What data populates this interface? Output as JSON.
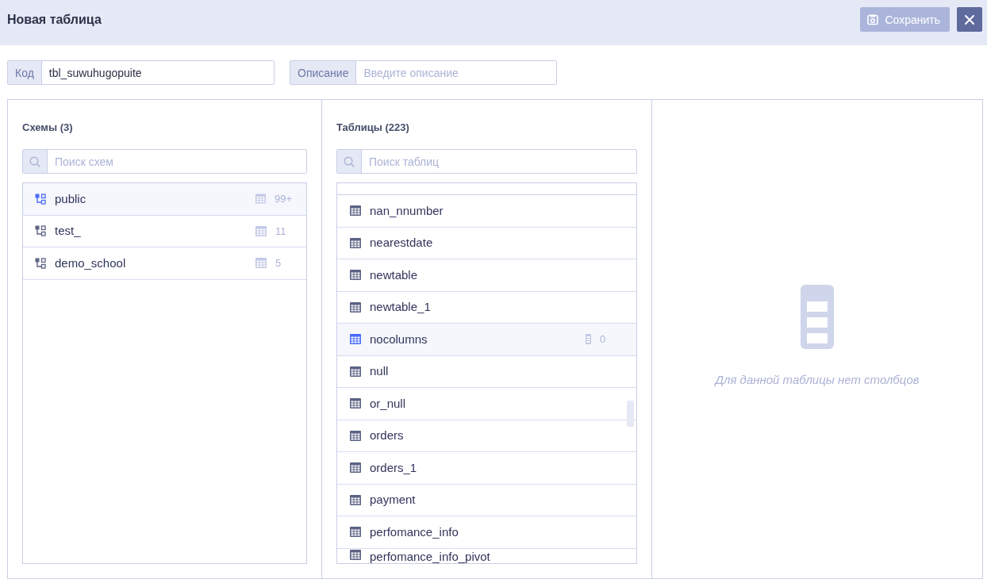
{
  "window": {
    "title": "Новая таблица"
  },
  "toolbar": {
    "save_button": {
      "label": "Сохранить",
      "disabled": true
    }
  },
  "fields": [
    {
      "label": "Код",
      "value": "tbl_suwuhugopuite"
    },
    {
      "label": "Описание",
      "placeholder": "Введите описание"
    }
  ],
  "schemas": {
    "title": "Схемы (3)",
    "search": {
      "placeholder": "Поиск схем"
    },
    "items": [
      {
        "name": "public",
        "count": "99+",
        "selected": true
      },
      {
        "name": "test_",
        "count": "11",
        "selected": false
      },
      {
        "name": "demo_school",
        "count": "5",
        "selected": false
      }
    ]
  },
  "tables": {
    "title": "Таблицы (223)",
    "search": {
      "placeholder": "Поиск таблиц"
    },
    "items": [
      {
        "name": "nan_nnumber",
        "selected": false
      },
      {
        "name": "nearestdate",
        "selected": false
      },
      {
        "name": "newtable",
        "selected": false
      },
      {
        "name": "newtable_1",
        "selected": false
      },
      {
        "name": "nocolumns",
        "selected": true,
        "column_count": "0"
      },
      {
        "name": "null",
        "selected": false
      },
      {
        "name": "or_null",
        "selected": false
      },
      {
        "name": "orders",
        "selected": false
      },
      {
        "name": "orders_1",
        "selected": false
      },
      {
        "name": "payment",
        "selected": false
      },
      {
        "name": "perfomance_info",
        "selected": false
      },
      {
        "name": "perfomance_info_pivot",
        "selected": false
      }
    ]
  },
  "columns_panel": {
    "empty_message": "Для данной таблицы нет столбцов"
  }
}
